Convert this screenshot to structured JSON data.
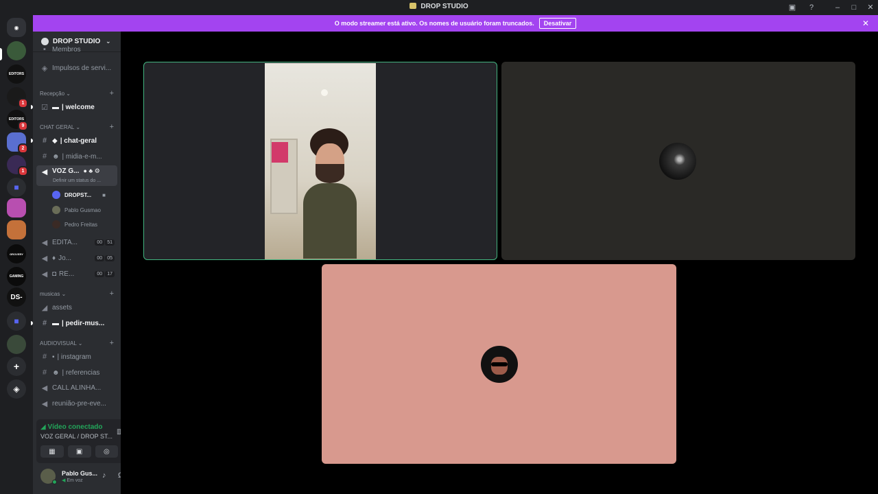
{
  "window": {
    "title": "DROP STUDIO"
  },
  "banner": {
    "message": "O modo streamer está ativo. Os nomes de usuário foram truncados.",
    "button": "Desativar"
  },
  "guilds": [
    {
      "label": "",
      "badge": ""
    },
    {
      "label": "EDITORS",
      "badge": ""
    },
    {
      "label": "",
      "badge": "1"
    },
    {
      "label": "EDITORS",
      "badge": "9"
    },
    {
      "label": "",
      "badge": "2"
    },
    {
      "label": "",
      "badge": "1"
    },
    {
      "label": "",
      "badge": ""
    },
    {
      "label": "",
      "badge": ""
    },
    {
      "label": "",
      "badge": ""
    },
    {
      "label": "GROVERY",
      "badge": ""
    },
    {
      "label": "GAMING",
      "badge": ""
    },
    {
      "label": "DS-",
      "badge": ""
    },
    {
      "label": "",
      "badge": ""
    },
    {
      "label": "",
      "badge": ""
    }
  ],
  "server": {
    "name": "DROP STUDIO"
  },
  "channels": {
    "top": {
      "members_partial": "Membros",
      "boosts": "Impulsos de servi..."
    },
    "cat_recepcao": "Recepção",
    "welcome": "| welcome",
    "cat_chat": "CHAT GERAL",
    "chat_geral": "| chat-geral",
    "midia": "| midia-e-m...",
    "voz_geral": "VOZ G...",
    "voz_status": "Definir um status do ...",
    "voice_users": [
      "DROPST...",
      "Pablo Gusmao",
      "Pedro Freitas"
    ],
    "editais": {
      "name": "EDITA...",
      "c1": "00",
      "c2": "51"
    },
    "jogos": {
      "name": "Jo...",
      "c1": "00",
      "c2": "05"
    },
    "re": {
      "name": "RE...",
      "c1": "00",
      "c2": "17"
    },
    "cat_musicas": "musicas",
    "assets": "assets",
    "pedir_mus": "| pedir-mus...",
    "cat_av": "AUDIOVISUAL",
    "instagram": "| instagram",
    "referencias": "| referencias",
    "call_alinha": "CALL ALINHA...",
    "reuniao": "reunião-pre-eve..."
  },
  "voice_panel": {
    "status": "Vídeo conectado",
    "sub": "VOZ GERAL / DROP ST..."
  },
  "user": {
    "name": "Pablo Gus...",
    "status": "Em voz"
  },
  "colors": {
    "accent": "#a344f0",
    "connected": "#23a55a",
    "tile3_bg": "#d8998e"
  }
}
